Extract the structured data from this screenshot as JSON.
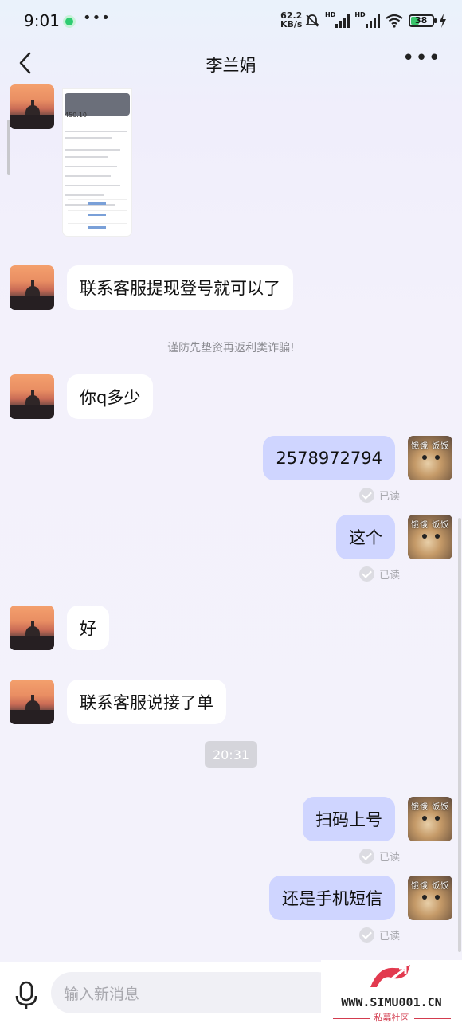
{
  "status_bar": {
    "time": "9:01",
    "more": "•••",
    "net_speed_value": "62.2",
    "net_speed_unit": "KB/s",
    "hd_1": "HD",
    "hd_2": "HD",
    "battery": "38"
  },
  "header": {
    "title": "李兰娟",
    "more": "•••"
  },
  "messages": [
    {
      "side": "left",
      "type": "image"
    },
    {
      "side": "left",
      "text": "联系客服提现登号就可以了"
    },
    {
      "side": "notice",
      "text": "谨防先垫资再返利类诈骗!"
    },
    {
      "side": "left",
      "text": "你q多少"
    },
    {
      "side": "right",
      "text": "2578972794",
      "status": "已读"
    },
    {
      "side": "right",
      "text": "这个",
      "status": "已读"
    },
    {
      "side": "left",
      "text": "好"
    },
    {
      "side": "left",
      "text": "联系客服说接了单"
    },
    {
      "side": "time",
      "text": "20:31"
    },
    {
      "side": "right",
      "text": "扫码上号",
      "status": "已读"
    },
    {
      "side": "right",
      "text": "还是手机短信",
      "status": "已读"
    }
  ],
  "screenshot": {
    "amount": "450.10"
  },
  "avatar_right_caption": "饿饿 饭饭",
  "input": {
    "placeholder": "输入新消息"
  },
  "watermark": {
    "url": "WWW.SIMU001.CN",
    "subtitle": "私募社区"
  },
  "colors": {
    "bubble_right": "#cfd5ff",
    "bubble_left": "#ffffff",
    "status_dot": "#2ecc71",
    "battery_fill": "#39c46a",
    "watermark_red": "#d33b4e"
  }
}
